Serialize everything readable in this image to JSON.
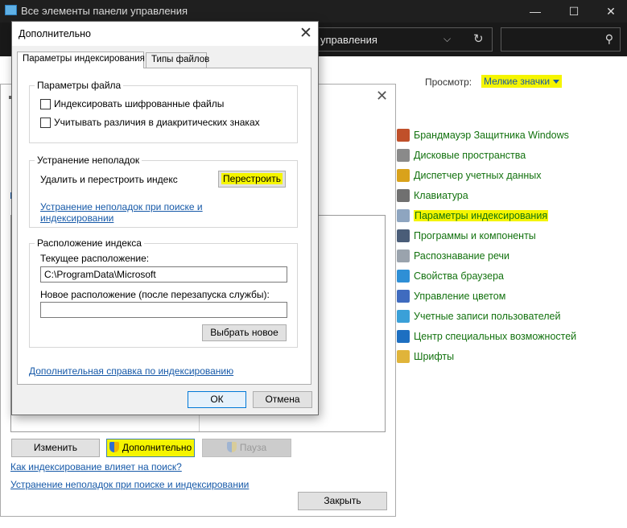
{
  "control_panel": {
    "title": "Все элементы панели управления",
    "address": "управления",
    "window_controls": {
      "minimize": "—",
      "maximize": "☐",
      "close": "✕"
    },
    "view_label": "Просмотр:",
    "view_value": "Мелкие значки",
    "items": [
      {
        "label": "Брандмауэр Защитника Windows",
        "icon": "firewall-icon",
        "color": "#c0502a"
      },
      {
        "label": "Дисковые пространства",
        "icon": "storage-spaces-icon",
        "color": "#8a8a8a"
      },
      {
        "label": "Диспетчер учетных данных",
        "icon": "credential-manager-icon",
        "color": "#d9a21b"
      },
      {
        "label": "Клавиатура",
        "icon": "keyboard-icon",
        "color": "#707070"
      },
      {
        "label": "Параметры индексирования",
        "icon": "indexing-icon",
        "color": "#8ea5c0",
        "highlighted": true
      },
      {
        "label": "Программы и компоненты",
        "icon": "programs-icon",
        "color": "#4a5d78"
      },
      {
        "label": "Распознавание речи",
        "icon": "microphone-icon",
        "color": "#9aa3ad"
      },
      {
        "label": "Свойства браузера",
        "icon": "internet-options-icon",
        "color": "#2e8fd6"
      },
      {
        "label": "Управление цветом",
        "icon": "color-management-icon",
        "color": "#3f6bbf"
      },
      {
        "label": "Учетные записи пользователей",
        "icon": "user-accounts-icon",
        "color": "#3aa0d8"
      },
      {
        "label": "Центр специальных возможностей",
        "icon": "accessibility-icon",
        "color": "#1d6fc1"
      },
      {
        "label": "Шрифты",
        "icon": "fonts-icon",
        "color": "#e0b43a"
      }
    ]
  },
  "indexing_window": {
    "buttons": {
      "modify": "Изменить",
      "advanced": "Дополнительно",
      "pause": "Пауза",
      "close": "Закрыть"
    },
    "links": {
      "how": "Как индексирование влияет на поиск?",
      "troubleshoot": "Устранение неполадок при поиске и индексировании"
    }
  },
  "advanced_dialog": {
    "title": "Дополнительно",
    "tabs": [
      "Параметры индексирования",
      "Типы файлов"
    ],
    "file_settings": {
      "caption": "Параметры файла",
      "encrypt_label": "Индексировать шифрованные файлы",
      "diacritics_label": "Учитывать различия в диакритических знаках",
      "encrypt_checked": false,
      "diacritics_checked": false
    },
    "troubleshooting": {
      "caption": "Устранение неполадок",
      "rebuild_text": "Удалить и перестроить индекс",
      "rebuild_button": "Перестроить",
      "link": "Устранение неполадок при поиске и индексировании"
    },
    "location": {
      "caption": "Расположение индекса",
      "current_label": "Текущее расположение:",
      "current_value": "C:\\ProgramData\\Microsoft",
      "new_label": "Новое расположение (после перезапуска службы):",
      "new_value": "",
      "choose_button": "Выбрать новое"
    },
    "help_link": "Дополнительная справка по индексированию",
    "ok": "ОК",
    "cancel": "Отмена"
  },
  "colors": {
    "highlight": "#f5f500",
    "link": "#1659a8",
    "cp_item_text": "#13720f",
    "dark_chrome": "#1f1f1f"
  }
}
